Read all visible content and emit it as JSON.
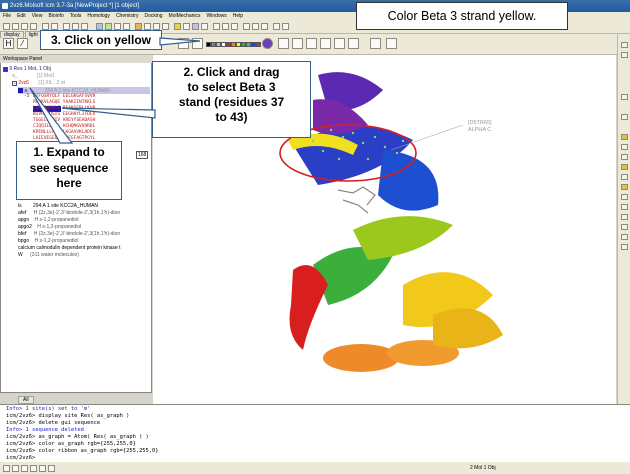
{
  "window": {
    "title": "2vz6.Molsoft icm 3.7-3a [NewProject *] [1 object]"
  },
  "menu": [
    "File",
    "Edit",
    "View",
    "Bioinfo",
    "Tools",
    "Homology",
    "Chemistry",
    "Docking",
    "MolMechanics",
    "Windows",
    "Help"
  ],
  "tabs": [
    "display",
    "light"
  ],
  "workspace": {
    "title": "Workspace Panel",
    "root": "9 Res 1 MoL 1 Obj",
    "items": [
      {
        "name": "a_",
        "desc": "[1] Mol1"
      },
      {
        "name": "2vz6",
        "desc": "[1] Xlt... 2 ot"
      },
      {
        "name": "a",
        "desc": "284 A 1 site KCC2A_HUMAN"
      }
    ],
    "sequence_rows": [
      {
        "n": "-5",
        "seq": "LTFQSRYQLF EELGKGAFSVVR"
      },
      {
        "n": "",
        "seq": "RCVKVLAGQE YAAKIINTKKLS"
      },
      {
        "n": "",
        "seq": "LSARDHQKLE REARICRLLKHP"
      },
      {
        "n": "",
        "seq": "NIVRLHDSIS EEGHHYLIFDLV"
      },
      {
        "n": "",
        "seq": "TGGELFEDIV AREYYSEADASH"
      },
      {
        "n": "",
        "seq": "CIQQILEAVL HCHQMGVVHRDL"
      },
      {
        "n": "",
        "seq": "KPENLLLASK LKGAAVKLADFG"
      },
      {
        "n": "",
        "seq": "LAIEVEGEQQ AWFGFAGTPGYL"
      }
    ],
    "lower_items": [
      {
        "name": "ls",
        "desc": "294 A 1 site KCC2A_HUMAN"
      },
      {
        "name": "afef",
        "desc": "H (2z,3e)-2',3'-bindole-2',3(1h,1'h)-dion"
      },
      {
        "name": "apgo",
        "desc": "H s-1,2-propanediol"
      },
      {
        "name": "apgo2",
        "desc": "H s-1,2-propanediol"
      },
      {
        "name": "bfef",
        "desc": "H (2z,3e)-2',3'-bindole-2',3(1h,1'h)-dion"
      },
      {
        "name": "bpgo",
        "desc": "H s-1,2-propanediol"
      },
      {
        "name": "",
        "desc": "calcium calmodulin dependent protein kinase t"
      },
      {
        "name": "W",
        "desc": "(311 water molecules)"
      }
    ],
    "badge": "168"
  },
  "callouts": {
    "top": "Color Beta 3 strand yellow.",
    "step3": "3. Click on yellow",
    "step2": [
      "2. Click and drag",
      "to select Beta 3",
      "stand (residues 37",
      "to 43)"
    ],
    "step1": [
      "1. Expand to",
      "see  sequence",
      "here"
    ]
  },
  "viewer": {
    "label1": "[D5TR65]",
    "label2": "ALPHA C"
  },
  "console": {
    "tab": "All",
    "lines": [
      "Info> 1 site(s) set to 'm'",
      "icm/2vz6> display site Res( as_graph )",
      "icm/2vz6> delete gui sequence",
      " Info> 1 sequence deleted",
      "icm/2vz6> as_graph = Atom( Res( as_graph ) )",
      "icm/2vz6> color as_graph rgb={255,255,0}",
      "icm/2vz6> color ribbon as_graph rgb={255,255,0}",
      "icm/2vz6>"
    ]
  },
  "status": {
    "right": "2 Mol 1 Obj"
  },
  "colors": {
    "highlight_ellipse": "#d62020",
    "selection_row": "#1a1ab8",
    "sequence_text": "#c01818"
  }
}
